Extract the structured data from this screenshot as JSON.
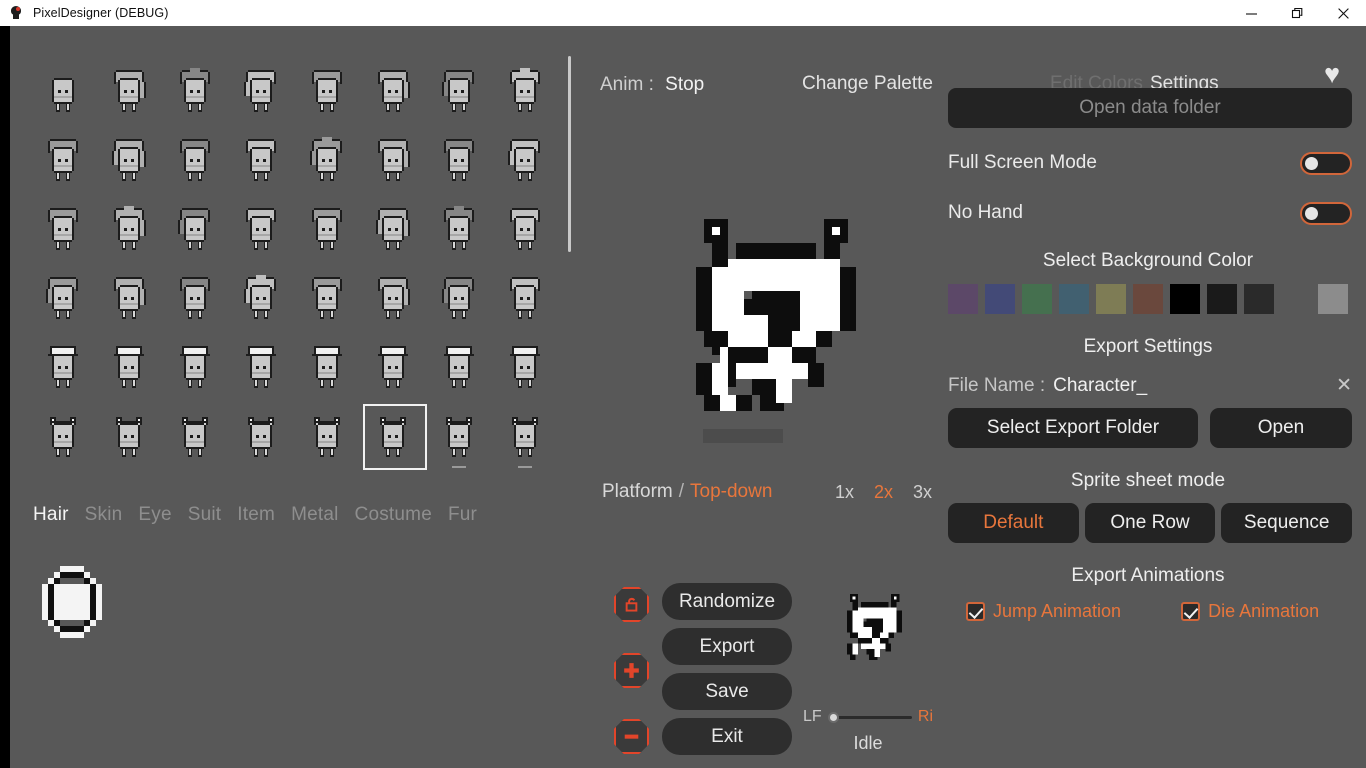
{
  "window": {
    "title": "PixelDesigner (DEBUG)",
    "icon": "app-icon",
    "minimize": "—",
    "maximize": "❐",
    "close": "✕"
  },
  "toolbar": {
    "anim_label": "Anim :",
    "anim_value": "Stop",
    "change_palette": "Change Palette",
    "edit_colors": "Edit Colors",
    "settings": "Settings",
    "favorite_icon": "♥"
  },
  "sprite_grid": {
    "columns": 8,
    "rows": 6,
    "selected_index": 45,
    "marked_indices": [
      46,
      47
    ],
    "cells": [
      {
        "style": "plain"
      },
      {
        "style": "hair1"
      },
      {
        "style": "hair2"
      },
      {
        "style": "hair3"
      },
      {
        "style": "hair4"
      },
      {
        "style": "hair5"
      },
      {
        "style": "hair6"
      },
      {
        "style": "hair7"
      },
      {
        "style": "hair8"
      },
      {
        "style": "hair9"
      },
      {
        "style": "hair10"
      },
      {
        "style": "hair11"
      },
      {
        "style": "hair12"
      },
      {
        "style": "hair13"
      },
      {
        "style": "hair14"
      },
      {
        "style": "hair15"
      },
      {
        "style": "hair16"
      },
      {
        "style": "hair17"
      },
      {
        "style": "hair18"
      },
      {
        "style": "hair19"
      },
      {
        "style": "hair20"
      },
      {
        "style": "hair21"
      },
      {
        "style": "hair22"
      },
      {
        "style": "hair23"
      },
      {
        "style": "hair24"
      },
      {
        "style": "hair25"
      },
      {
        "style": "hair26"
      },
      {
        "style": "hair27"
      },
      {
        "style": "hair28"
      },
      {
        "style": "hair29"
      },
      {
        "style": "hair30"
      },
      {
        "style": "hair31"
      },
      {
        "style": "hat1"
      },
      {
        "style": "hat2"
      },
      {
        "style": "hat3"
      },
      {
        "style": "hat4"
      },
      {
        "style": "hat5"
      },
      {
        "style": "hat6"
      },
      {
        "style": "hat7"
      },
      {
        "style": "hat8"
      },
      {
        "style": "ear1"
      },
      {
        "style": "ear2"
      },
      {
        "style": "ear3"
      },
      {
        "style": "ear4"
      },
      {
        "style": "ear5"
      },
      {
        "style": "ear6"
      },
      {
        "style": "ear7"
      },
      {
        "style": "ear8"
      }
    ]
  },
  "categories": [
    {
      "label": "Hair",
      "active": true
    },
    {
      "label": "Skin",
      "active": false
    },
    {
      "label": "Eye",
      "active": false
    },
    {
      "label": "Suit",
      "active": false
    },
    {
      "label": "Item",
      "active": false
    },
    {
      "label": "Metal",
      "active": false
    },
    {
      "label": "Costume",
      "active": false
    },
    {
      "label": "Fur",
      "active": false
    }
  ],
  "swatch": {
    "icon": "ring-swatch"
  },
  "preview": {
    "platform_label": "Platform",
    "separator": "/",
    "mode": "Top-down",
    "zoom_levels": [
      {
        "label": "1x",
        "active": false
      },
      {
        "label": "2x",
        "active": true
      },
      {
        "label": "3x",
        "active": false
      }
    ]
  },
  "actions": {
    "icons": [
      {
        "name": "lock-icon",
        "glyph": "lock"
      },
      {
        "name": "plus-icon",
        "glyph": "plus"
      },
      {
        "name": "minus-icon",
        "glyph": "minus"
      }
    ],
    "buttons": [
      "Randomize",
      "Export",
      "Save",
      "Exit"
    ]
  },
  "anim_slider": {
    "left_label": "LF",
    "right_label": "Ri",
    "value": 0,
    "state_label": "Idle"
  },
  "settings": {
    "open_data_folder": "Open data folder",
    "full_screen_mode": {
      "label": "Full Screen Mode",
      "on": false
    },
    "no_hand": {
      "label": "No Hand",
      "on": false
    },
    "background_color_title": "Select Background Color",
    "background_colors": [
      "#5c4868",
      "#434a77",
      "#45704f",
      "#416070",
      "#7e7c55",
      "#6a483d",
      "#000000",
      "#1a1a1a",
      "#2a2a2a"
    ],
    "background_color_extra": "#8c8c8c",
    "export_settings_title": "Export Settings",
    "file_name_label": "File Name :",
    "file_name_value": "Character_",
    "file_name_clear": "✕",
    "select_export_folder": "Select Export Folder",
    "open": "Open",
    "sprite_sheet_mode_title": "Sprite sheet mode",
    "sprite_sheet_modes": [
      {
        "label": "Default",
        "active": true
      },
      {
        "label": "One Row",
        "active": false
      },
      {
        "label": "Sequence",
        "active": false
      }
    ],
    "export_animations_title": "Export Animations",
    "export_animations": [
      {
        "label": "Jump Animation",
        "checked": true
      },
      {
        "label": "Die Animation",
        "checked": true
      }
    ]
  },
  "colors": {
    "accent": "#e8763c",
    "accent_red": "#e2452a",
    "panel_bg": "#585858",
    "button_bg": "#232323"
  }
}
